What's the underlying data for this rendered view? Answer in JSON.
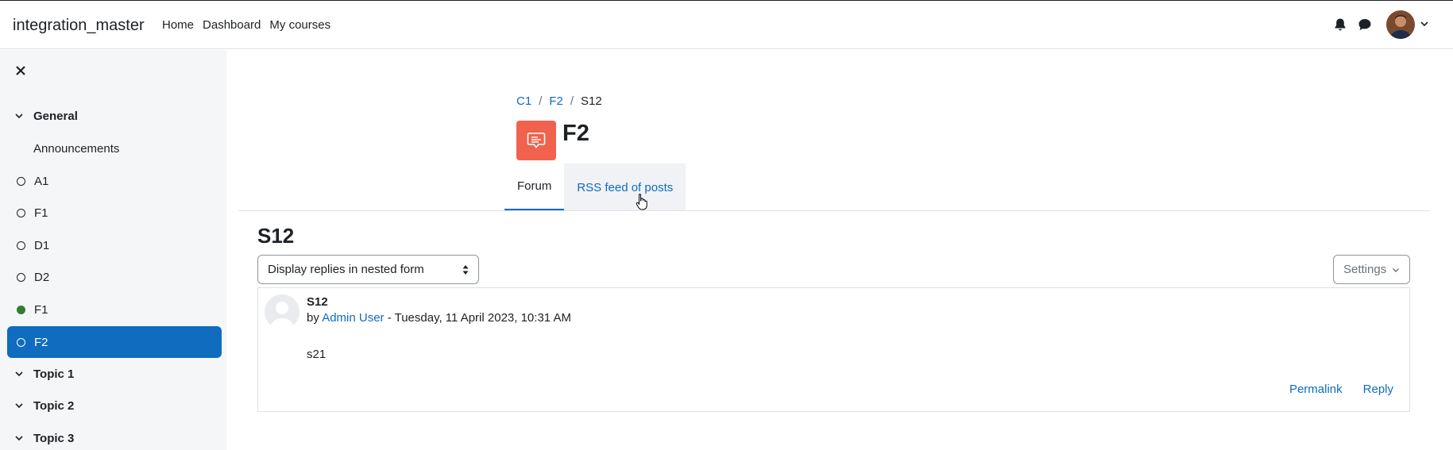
{
  "navbar": {
    "site_name": "integration_master",
    "links": [
      "Home",
      "Dashboard",
      "My courses"
    ],
    "icons": [
      "bell-icon",
      "chat-icon"
    ]
  },
  "sidebar": {
    "sections": [
      {
        "title": "General",
        "items": [
          {
            "label": "Announcements",
            "status": "none"
          },
          {
            "label": "A1",
            "status": "incomplete"
          },
          {
            "label": "F1",
            "status": "incomplete"
          },
          {
            "label": "D1",
            "status": "incomplete"
          },
          {
            "label": "D2",
            "status": "incomplete"
          },
          {
            "label": "F1",
            "status": "complete"
          },
          {
            "label": "F2",
            "status": "incomplete",
            "active": true
          }
        ]
      },
      {
        "title": "Topic 1"
      },
      {
        "title": "Topic 2"
      },
      {
        "title": "Topic 3"
      }
    ]
  },
  "breadcrumb": [
    "C1",
    "F2",
    "S12"
  ],
  "page": {
    "title": "F2",
    "tabs": [
      {
        "label": "Forum",
        "active": true
      },
      {
        "label": "RSS feed of posts",
        "active": false
      }
    ]
  },
  "discussion": {
    "title": "S12",
    "display_mode": "Display replies in nested form",
    "settings_label": "Settings",
    "post": {
      "subject": "S12",
      "by": "by",
      "author": "Admin User",
      "date": " - Tuesday, 11 April 2023, 10:31 AM",
      "body": "s21",
      "actions": [
        "Permalink",
        "Reply"
      ]
    }
  },
  "colors": {
    "accent": "#0f6cbf",
    "forum_icon": "#f0624d",
    "complete": "#357a32"
  }
}
